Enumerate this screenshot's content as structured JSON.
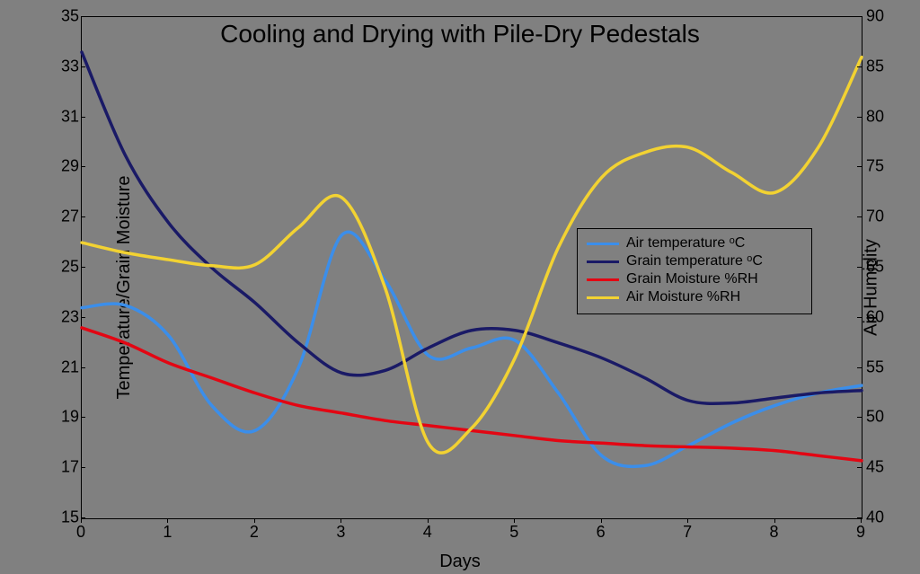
{
  "chart_data": {
    "type": "line",
    "title": "Cooling and Drying with Pile-Dry Pedestals",
    "xlabel": "Days",
    "ylabel_left": "Temperature/Grain Moisture",
    "ylabel_right": "Air Humidity",
    "x": [
      0,
      0.5,
      1,
      1.5,
      2,
      2.5,
      3,
      3.5,
      4,
      4.5,
      5,
      5.5,
      6,
      6.5,
      7,
      7.5,
      8,
      8.5,
      9
    ],
    "x_ticks": [
      0,
      1,
      2,
      3,
      4,
      5,
      6,
      7,
      8,
      9
    ],
    "y1_ticks": [
      15,
      17,
      19,
      21,
      23,
      25,
      27,
      29,
      31,
      33,
      35
    ],
    "y2_ticks": [
      40,
      45,
      50,
      55,
      60,
      65,
      70,
      75,
      80,
      85,
      90
    ],
    "y1_range": [
      15,
      35
    ],
    "y2_range": [
      40,
      90
    ],
    "series": [
      {
        "name": "Air temperature ᵒC",
        "axis": "left",
        "color": "#3b8eea",
        "values": [
          23.4,
          23.5,
          22.3,
          19.5,
          18.5,
          21.0,
          26.3,
          24.5,
          21.5,
          21.8,
          22.1,
          20.0,
          17.5,
          17.1,
          17.9,
          18.8,
          19.5,
          20.0,
          20.3
        ]
      },
      {
        "name": "Grain temperature ᵒC",
        "axis": "left",
        "color": "#1a1a66",
        "values": [
          33.6,
          29.5,
          26.8,
          25.0,
          23.6,
          22.0,
          20.8,
          20.9,
          21.8,
          22.5,
          22.5,
          22.0,
          21.4,
          20.6,
          19.7,
          19.6,
          19.8,
          20.0,
          20.1
        ]
      },
      {
        "name": "Grain Moisture %RH",
        "axis": "left",
        "color": "#e30613",
        "values": [
          22.6,
          22.0,
          21.2,
          20.6,
          20.0,
          19.5,
          19.2,
          18.9,
          18.7,
          18.5,
          18.3,
          18.1,
          18.0,
          17.9,
          17.85,
          17.8,
          17.7,
          17.5,
          17.3
        ]
      },
      {
        "name": "Air Moisture %RH",
        "axis": "right",
        "color": "#f2d232",
        "values": [
          67.5,
          66.5,
          65.8,
          65.2,
          65.3,
          69.0,
          72.0,
          63.0,
          47.5,
          49.0,
          56.0,
          67.0,
          74.0,
          76.5,
          77.0,
          74.5,
          72.5,
          77.0,
          86.0
        ]
      }
    ],
    "legend": {
      "items": [
        "Air temperature ᵒC",
        "Grain temperature ᵒC",
        "Grain Moisture %RH",
        "Air Moisture %RH"
      ]
    }
  }
}
